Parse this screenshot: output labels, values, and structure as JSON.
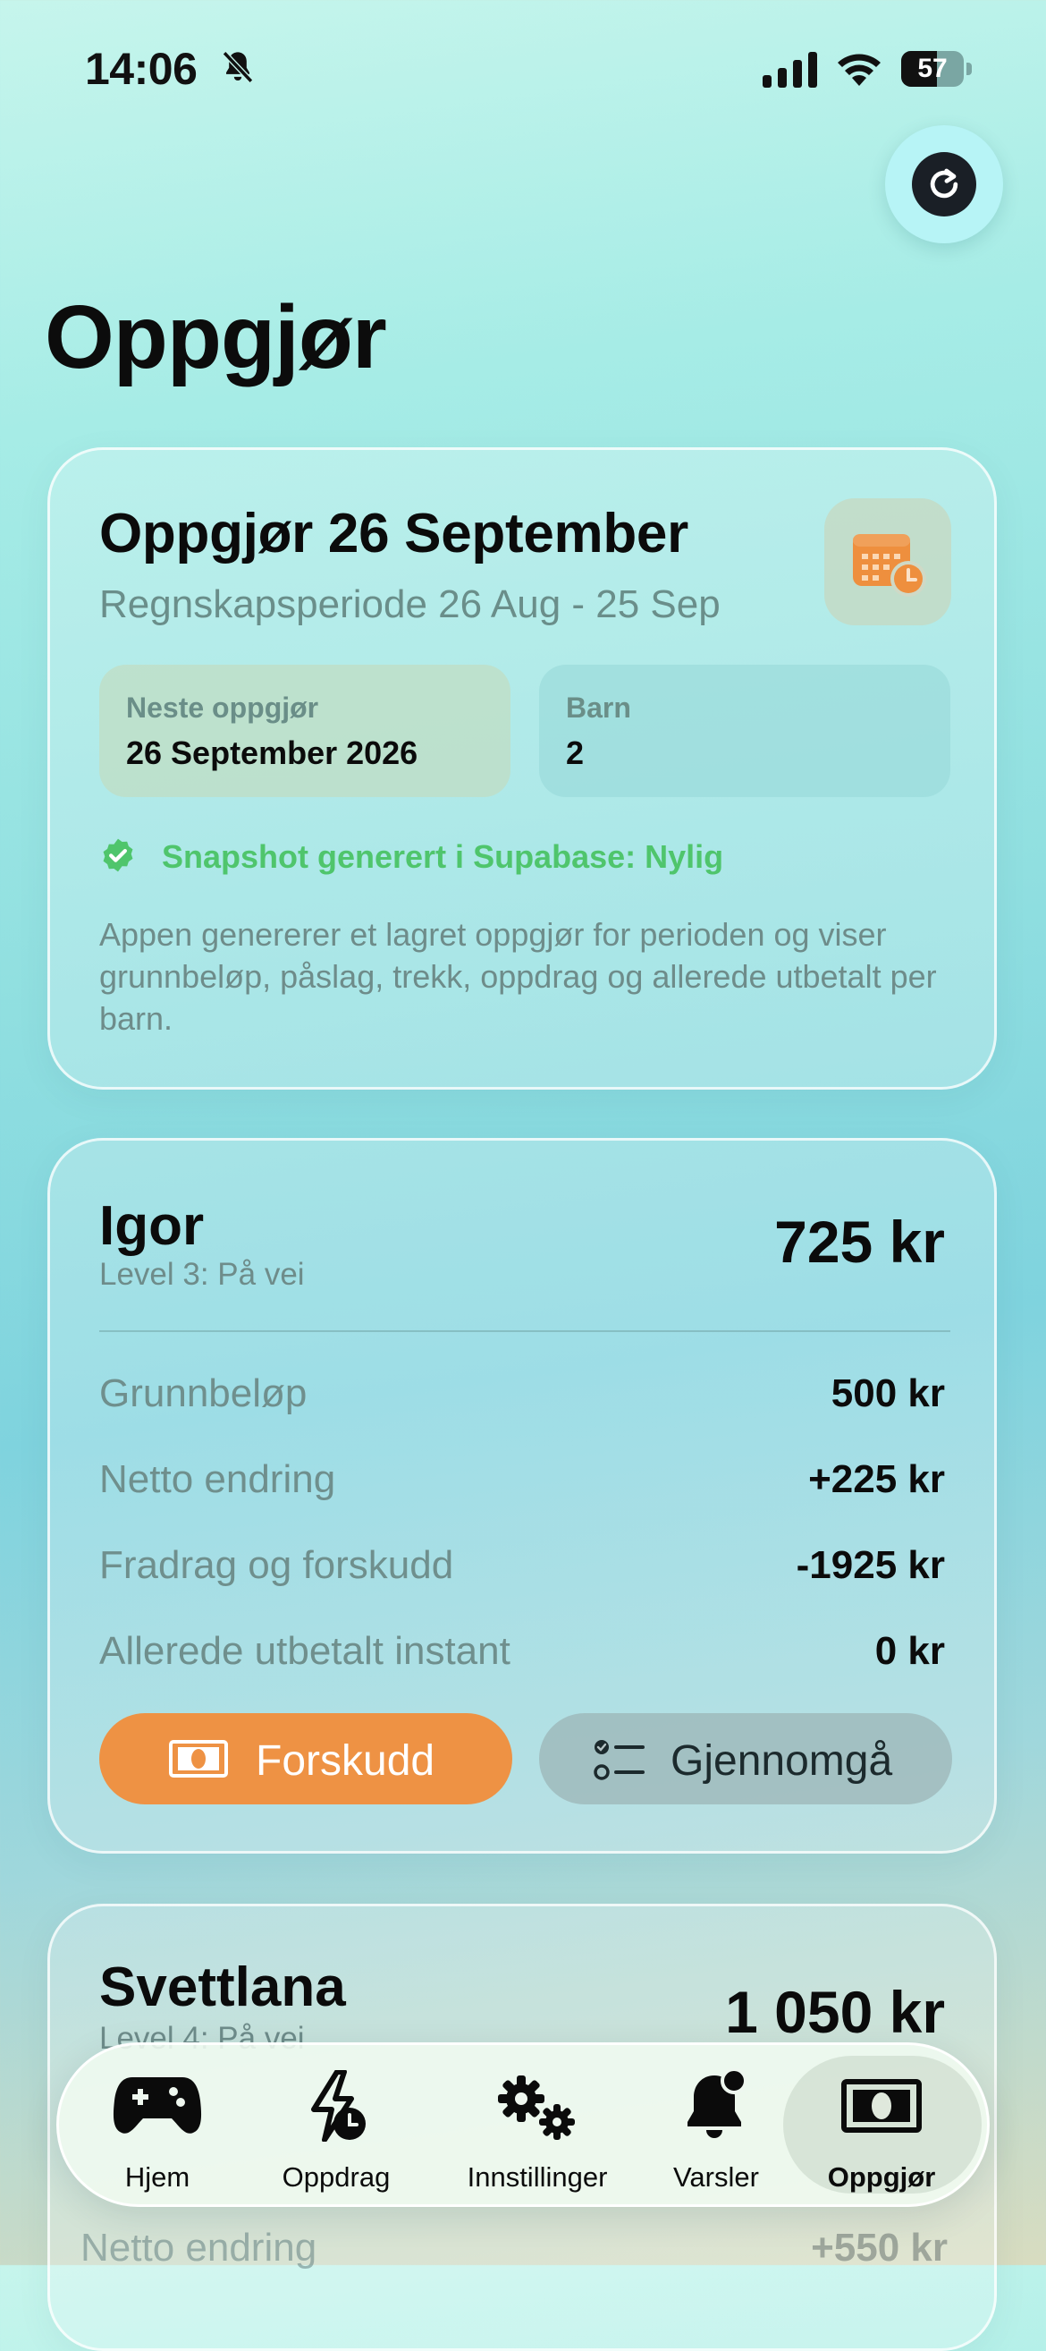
{
  "status_bar": {
    "time": "14:06",
    "battery": "57",
    "battery_level": 0.57
  },
  "page": {
    "title": "Oppgjør"
  },
  "summary": {
    "title": "Oppgjør 26 September",
    "period": "Regnskapsperiode 26 Aug - 25 Sep",
    "next_label": "Neste oppgjør",
    "next_value": "26 September 2026",
    "children_label": "Barn",
    "children_value": "2",
    "snapshot": "Snapshot generert i Supabase: Nylig",
    "description": "Appen genererer et lagret oppgjør for perioden og viser grunnbeløp, påslag, trekk, oppdrag og allerede utbetalt per barn."
  },
  "children": [
    {
      "name": "Igor",
      "level": "Level 3: På vei",
      "total": "725 kr",
      "rows": [
        {
          "label": "Grunnbeløp",
          "value": "500 kr"
        },
        {
          "label": "Netto endring",
          "value": "+225 kr"
        },
        {
          "label": "Fradrag og forskudd",
          "value": "-1925 kr"
        },
        {
          "label": "Allerede utbetalt instant",
          "value": "0 kr"
        }
      ],
      "advance_label": "Forskudd",
      "review_label": "Gjennomgå"
    },
    {
      "name": "Svettlana",
      "level": "Level 4: På vei",
      "total": "1 050 kr",
      "rows": [
        {
          "label": "Netto endring",
          "value": "+550 kr"
        }
      ]
    }
  ],
  "tabbar": {
    "items": [
      {
        "label": "Hjem",
        "icon": "gamepad-icon"
      },
      {
        "label": "Oppdrag",
        "icon": "bolt-clock-icon"
      },
      {
        "label": "Innstillinger",
        "icon": "gears-icon"
      },
      {
        "label": "Varsler",
        "icon": "bell-badge-icon"
      },
      {
        "label": "Oppgjør",
        "icon": "banknote-icon",
        "active": true
      }
    ]
  },
  "colors": {
    "accent_orange": "#ee9244",
    "success_green": "#4fc56c"
  }
}
